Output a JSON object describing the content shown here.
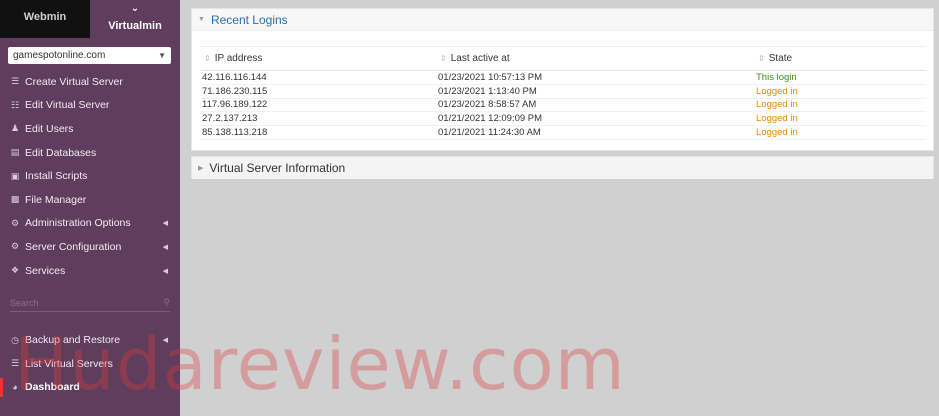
{
  "tabs": {
    "webmin": "Webmin",
    "virtualmin": "Virtualmin"
  },
  "domain": {
    "selected": "gamespotonline.com"
  },
  "menu": [
    {
      "label": "Create Virtual Server",
      "icon": "plus-icon"
    },
    {
      "label": "Edit Virtual Server",
      "icon": "sliders-icon"
    },
    {
      "label": "Edit Users",
      "icon": "users-icon"
    },
    {
      "label": "Edit Databases",
      "icon": "database-icon"
    },
    {
      "label": "Install Scripts",
      "icon": "terminal-icon"
    },
    {
      "label": "File Manager",
      "icon": "folder-icon"
    },
    {
      "label": "Administration Options",
      "icon": "gear-icon",
      "has_submenu": true
    },
    {
      "label": "Server Configuration",
      "icon": "cogs-icon",
      "has_submenu": true
    },
    {
      "label": "Services",
      "icon": "puzzle-icon",
      "has_submenu": true
    }
  ],
  "search": {
    "placeholder": "Search"
  },
  "menu2": [
    {
      "label": "Backup and Restore",
      "icon": "history-icon",
      "has_submenu": true
    },
    {
      "label": "List Virtual Servers",
      "icon": "list-icon"
    },
    {
      "label": "Dashboard",
      "icon": "dashboard-icon",
      "active": true
    }
  ],
  "recent_logins": {
    "title": "Recent Logins",
    "columns": [
      "IP address",
      "Last active at",
      "State"
    ],
    "rows": [
      {
        "ip": "42.116.116.144",
        "last_active": "01/23/2021 10:57:13 PM",
        "state": "This login",
        "state_type": "this"
      },
      {
        "ip": "71.186.230.115",
        "last_active": "01/23/2021 1:13:40 PM",
        "state": "Logged in",
        "state_type": "logged"
      },
      {
        "ip": "117.96.189.122",
        "last_active": "01/23/2021 8:58:57 AM",
        "state": "Logged in",
        "state_type": "logged"
      },
      {
        "ip": "27.2.137.213",
        "last_active": "01/21/2021 12:09:09 PM",
        "state": "Logged in",
        "state_type": "logged"
      },
      {
        "ip": "85.138.113.218",
        "last_active": "01/21/2021 11:24:30 AM",
        "state": "Logged in",
        "state_type": "logged"
      }
    ]
  },
  "virtual_server_info": {
    "title": "Virtual Server Information"
  },
  "watermark": "Hudareview.com",
  "colors": {
    "sidebar_bg": "#5f3d5c",
    "accent_red": "#e33333",
    "link_blue": "#2a6fa8",
    "state_green": "#3d8a1f",
    "state_orange": "#e58a00"
  }
}
